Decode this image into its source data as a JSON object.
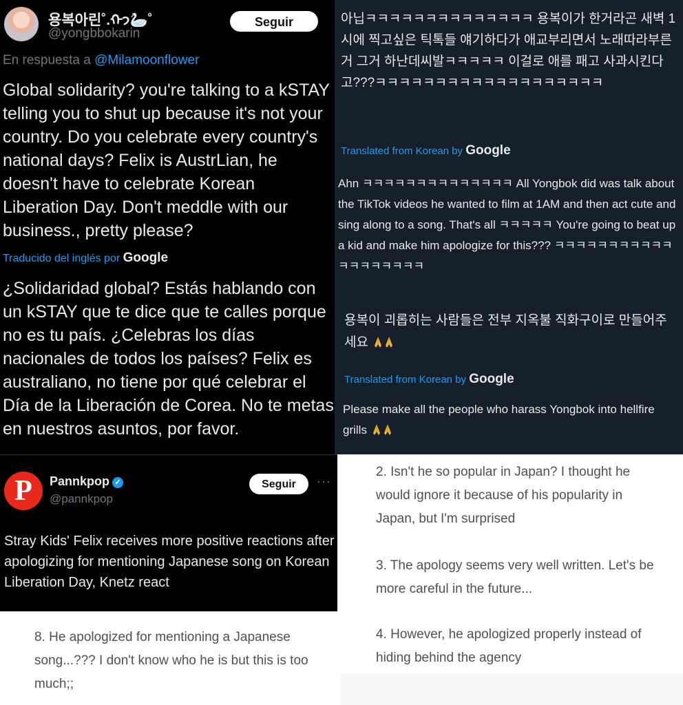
{
  "tweet_es": {
    "display_name": "용복아린˚.ᡣ𐭩🦢˚",
    "handle": "@yongbbokarin",
    "follow_label": "Seguir",
    "reply_prefix": "En respuesta a",
    "reply_mention": "@Milamoonflower",
    "text": "Global solidarity? you're talking to a kSTAY telling you to shut up because it's not your country. Do you celebrate every country's national days? Felix is AustrLian, he doesn't have to celebrate Korean Liberation Day. Don't meddle with our business., pretty please?",
    "translated_label": "Traducido del inglés por",
    "translated_provider": "Google",
    "translation": "¿Solidaridad global? Estás hablando con un kSTAY que te dice que te calles porque no es tu país. ¿Celebras los días nacionales de todos los países? Felix es australiano, no tiene por qué celebrar el Día de la Liberación de Corea. No te metas en nuestros asuntos, por favor."
  },
  "tweet_ko": {
    "text1": "아닙ㅋㅋㅋㅋㅋㅋㅋㅋㅋㅋㅋㅋㅋㅋ 용복이가 한거라곤 새벽 1시에 찍고싶은 틱톡들 얘기하다가 애교부리면서 노래따라부른거 그거 하난데씨발ㅋㅋㅋㅋㅋ 이걸로 애를 패고 사과시킨다고???ㅋㅋㅋㅋㅋㅋㅋㅋㅋㅋㅋㅋㅋㅋㅋㅋㅋㅋㅋ",
    "translated_label": "Translated from Korean by",
    "translated_provider": "Google",
    "translation1": "Ahn ㅋㅋㅋㅋㅋㅋㅋㅋㅋㅋㅋㅋㅋㅋ All Yongbok did was talk about the TikTok videos he wanted to film at 1AM and then act cute and sing along to a song. That's all ㅋㅋㅋㅋㅋ You're going to beat up a kid and make him apologize for this??? ㅋㅋㅋㅋㅋㅋㅋㅋㅋㅋㅋㅋㅋㅋㅋㅋㅋㅋㅋ",
    "text2": "용복이 괴롭히는 사람들은 전부 지옥불 직화구이로 만들어주세요",
    "translation2": "Please make all the people who harass Yongbok into hellfire grills",
    "prayer_icon": "folded-hands-icon"
  },
  "tweet_pannkpop": {
    "display_name": "Pannkpop",
    "handle": "@pannkpop",
    "avatar_letter": "P",
    "follow_label": "Seguir",
    "more_label": "···",
    "text": "Stray Kids' Felix receives more positive reactions after apologizing for mentioning Japanese song on Korean Liberation Day, Knetz react"
  },
  "comments_right": [
    "2. Isn't he so popular in Japan? I thought he would ignore it because of his popularity in Japan, but I'm surprised",
    "3. The apology seems very well written. Let's be more careful in the future...",
    "4. However, he apologized properly instead of hiding behind the agency"
  ],
  "comments_left": [
    "8. He apologized for mentioning a Japanese song...??? I don't know who he is but this is too much;;"
  ],
  "colors": {
    "twitter_blue": "#1d9bf0",
    "dim_navy": "#15202b",
    "black": "#000000",
    "pannkpop_red": "#e8291c"
  }
}
